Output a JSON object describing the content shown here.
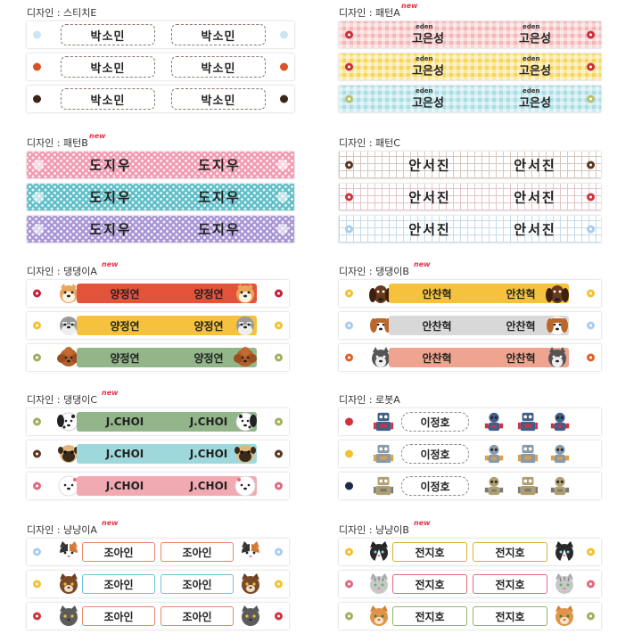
{
  "new_badge": "new",
  "sections": {
    "stitch_e": {
      "title": "디자인 : 스티치E",
      "rows": [
        {
          "name": "박소민",
          "dot": "#cce4f4"
        },
        {
          "name": "박소민",
          "dot": "#d9532a"
        },
        {
          "name": "박소민",
          "dot": "#3a2418"
        }
      ]
    },
    "pattern_a": {
      "title": "디자인 : 패턴A",
      "rows": [
        {
          "name": "고은성",
          "tag": "eden",
          "bg": "#f4b6b6",
          "dot": "#c8303a"
        },
        {
          "name": "고은성",
          "tag": "eden",
          "bg": "#f6d65a",
          "dot": "#c8303a"
        },
        {
          "name": "고은성",
          "tag": "eden",
          "bg": "#a8dde4",
          "dot": "#b8c070"
        }
      ]
    },
    "pattern_b": {
      "title": "디자인 : 패턴B",
      "rows": [
        {
          "name": "도지우",
          "bg": "#f29ab2"
        },
        {
          "name": "도지우",
          "bg": "#5fbfc8"
        },
        {
          "name": "도지우",
          "bg": "#a995d6"
        }
      ]
    },
    "pattern_c": {
      "title": "디자인 : 패턴C",
      "rows": [
        {
          "name": "안서진",
          "dot": "#5a3422"
        },
        {
          "name": "안서진",
          "dot": "#d1323d"
        },
        {
          "name": "안서진",
          "dot": "#a9cdef"
        }
      ]
    },
    "doggy_a": {
      "title": "디자인 : 댕댕이A",
      "rows": [
        {
          "name": "양정연",
          "pill": "#e5523a",
          "dot": "#c8203a"
        },
        {
          "name": "양정연",
          "pill": "#f6c23d",
          "dot": "#f2c230"
        },
        {
          "name": "양정연",
          "pill": "#93b58a",
          "dot": "#a0b060"
        }
      ]
    },
    "doggy_b": {
      "title": "디자인 : 댕댕이B",
      "rows": [
        {
          "name": "안찬혁",
          "pill": "#f6c23d",
          "dot": "#f2c230"
        },
        {
          "name": "안찬혁",
          "pill": "#d8d8d8",
          "dot": "#a9cdef"
        },
        {
          "name": "안찬혁",
          "pill": "#eea48e",
          "dot": "#e0602a"
        }
      ]
    },
    "doggy_c": {
      "title": "디자인 : 댕댕이C",
      "rows": [
        {
          "name": "J.CHOI",
          "pill": "#93b58a",
          "dot": "#a0b060"
        },
        {
          "name": "J.CHOI",
          "pill": "#9fd8dc",
          "dot": "#5a3422"
        },
        {
          "name": "J.CHOI",
          "pill": "#f2aab2",
          "dot": "#e06a80"
        }
      ]
    },
    "robot_a": {
      "title": "디자인 : 로봇A",
      "rows": [
        {
          "name": "이정호",
          "dot": "#d1323d"
        },
        {
          "name": "이정호",
          "dot": "#f2c230"
        },
        {
          "name": "이정호",
          "dot": "#1c2a4a"
        }
      ]
    },
    "cat_a": {
      "title": "디자인 : 냥냥이A",
      "rows": [
        {
          "name": "조아인",
          "border": "#e7856a",
          "dot": "#a9cdef"
        },
        {
          "name": "조아인",
          "border": "#6fc3d6",
          "dot": "#f2c230"
        },
        {
          "name": "조아인",
          "border": "#e7856a",
          "dot": "#d1323d"
        }
      ]
    },
    "cat_b": {
      "title": "디자인 : 냥냥이B",
      "rows": [
        {
          "name": "전지호",
          "border": "#d4b23a",
          "dot": "#f2c230"
        },
        {
          "name": "전지호",
          "border": "#e56a84",
          "dot": "#e06a80"
        },
        {
          "name": "전지호",
          "border": "#8fb46a",
          "dot": "#a0b060"
        }
      ]
    }
  }
}
